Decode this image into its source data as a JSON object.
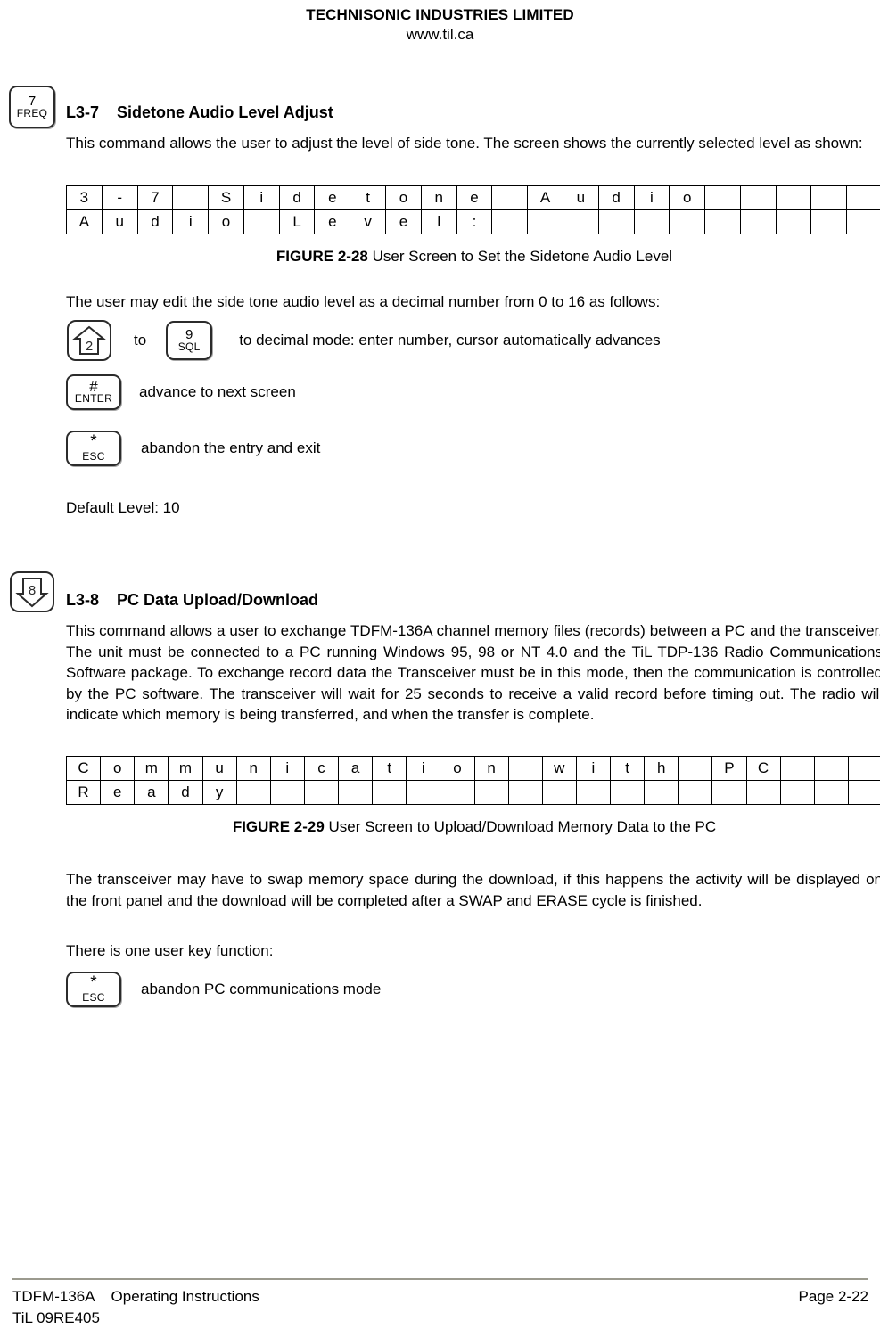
{
  "header": {
    "company": "TECHNISONIC INDUSTRIES LIMITED",
    "website": "www.til.ca"
  },
  "sections": [
    {
      "id": "l3-7",
      "margin_key": {
        "top": "7",
        "bottom": "FREQ"
      },
      "number": "L3-7",
      "title": "Sidetone Audio Level Adjust",
      "intro": "This command allows the user to adjust the level of side tone. The screen shows the currently selected level as shown:",
      "screen": {
        "columns": 23,
        "row1": [
          "3",
          "-",
          "7",
          "",
          "S",
          "i",
          "d",
          "e",
          "t",
          "o",
          "n",
          "e",
          "",
          "A",
          "u",
          "d",
          "i",
          "o",
          "",
          "",
          "",
          "",
          ""
        ],
        "row2": [
          "A",
          "u",
          "d",
          "i",
          "o",
          "",
          "L",
          "e",
          "v",
          "e",
          "l",
          ":",
          "",
          "",
          "",
          "",
          "",
          "",
          "",
          "",
          "",
          "",
          ""
        ]
      },
      "figure": {
        "label": "FIGURE 2-28",
        "caption": "User Screen to Set the Sidetone Audio Level"
      },
      "edit_note": "The user may edit the side tone audio level as a decimal number from 0 to 16 as follows:",
      "key_rows": [
        {
          "key_a": {
            "shape": "up-arrow",
            "digit": "2"
          },
          "connector": "to",
          "key_b": {
            "shape": "box",
            "top": "9",
            "bottom": "SQL"
          },
          "description": "to decimal mode: enter number, cursor automatically advances"
        },
        {
          "key_a": {
            "shape": "box",
            "top": "#",
            "bottom": "ENTER"
          },
          "description": "advance to next screen"
        },
        {
          "key_a": {
            "shape": "box",
            "top": "*",
            "bottom": "ESC"
          },
          "description": "abandon the entry and exit"
        }
      ],
      "default_level": "Default Level: 10"
    },
    {
      "id": "l3-8",
      "margin_key": {
        "shape": "down-arrow",
        "digit": "8"
      },
      "number": "L3-8",
      "title": "PC Data Upload/Download",
      "intro": "This command allows a user to exchange TDFM-136A channel memory files (records) between a PC and the transceiver. The unit must be connected to a PC running Windows 95, 98 or NT 4.0 and the TiL TDP-136 Radio Communications Software package. To exchange record data the Transceiver must be in this mode, then the communication is controlled by the PC software. The transceiver will wait for 25 seconds to receive a valid record before timing out. The radio will indicate which memory is being transferred, and when the transfer is complete.",
      "screen": {
        "columns": 24,
        "row1": [
          "C",
          "o",
          "m",
          "m",
          "u",
          "n",
          "i",
          "c",
          "a",
          "t",
          "i",
          "o",
          "n",
          "",
          "w",
          "i",
          "t",
          "h",
          "",
          "P",
          "C",
          "",
          "",
          ""
        ],
        "row2": [
          "R",
          "e",
          "a",
          "d",
          "y",
          "",
          "",
          "",
          "",
          "",
          "",
          "",
          "",
          "",
          "",
          "",
          "",
          "",
          "",
          "",
          "",
          "",
          "",
          ""
        ]
      },
      "figure": {
        "label": "FIGURE 2-29",
        "caption": "User Screen to Upload/Download Memory Data to the PC"
      },
      "swap_note": "The transceiver may have to swap memory space during the download, if this happens the activity will be displayed on the front panel and the download will be completed after a SWAP and ERASE cycle is finished.",
      "user_key_note": "There is one user key function:",
      "key_rows": [
        {
          "key_a": {
            "shape": "box",
            "top": "*",
            "bottom": "ESC"
          },
          "description": "abandon PC communications mode"
        }
      ]
    }
  ],
  "footer": {
    "product": "TDFM-136A",
    "doc_type": "Operating Instructions",
    "doc_code": "TiL 09RE405",
    "page": "Page 2-22"
  }
}
